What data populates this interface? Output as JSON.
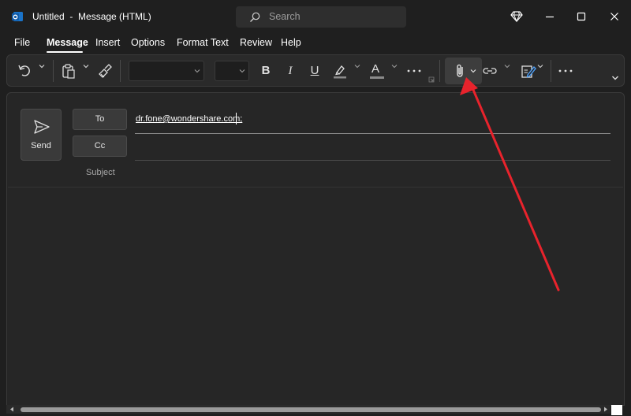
{
  "window": {
    "title": "Untitled  -  Message (HTML)",
    "search_placeholder": "Search",
    "icons": [
      "outlook-icon",
      "diamond-icon",
      "minimize-icon",
      "maximize-icon",
      "close-icon"
    ]
  },
  "menu": {
    "items": [
      "File",
      "Message",
      "Insert",
      "Options",
      "Format Text",
      "Review",
      "Help"
    ],
    "active": "Message"
  },
  "ribbon": {
    "font_name": "",
    "font_size": "",
    "icons": [
      "undo-icon",
      "paste-icon",
      "format-painter-icon",
      "bold-icon",
      "italic-icon",
      "underline-icon",
      "highlight-icon",
      "font-color-icon",
      "more-icon",
      "dialog-launcher-icon",
      "attach-file-icon",
      "link-icon",
      "signature-icon",
      "overflow-icon",
      "collapse-ribbon-icon"
    ],
    "bold_glyph": "B",
    "italic_glyph": "I",
    "underline_glyph": "U",
    "font_color_glyph": "A"
  },
  "compose": {
    "send_label": "Send",
    "to_label": "To",
    "cc_label": "Cc",
    "subject_label": "Subject",
    "to_value": "dr.fone@wondershare.com;",
    "cc_value": "",
    "subject_value": ""
  },
  "annotation": {
    "arrow_color": "#e8232c",
    "points_to": "attach-file-button"
  },
  "colors": {
    "background": "#1f1f1f",
    "ribbon": "#2a2a2a",
    "compose": "#262626",
    "button": "#3a3a3a"
  }
}
